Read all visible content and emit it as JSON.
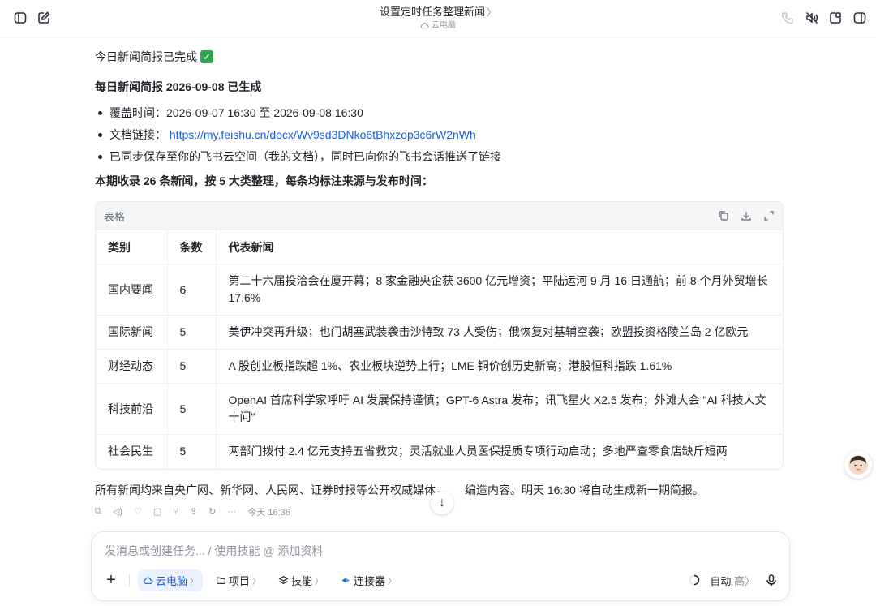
{
  "header": {
    "title": "设置定时任务整理新闻",
    "title_chevron": "〉",
    "subtitle": "云电脑"
  },
  "message": {
    "done_line": "今日新闻简报已完成",
    "heading": "每日新闻简报 2026-09-08 已生成",
    "bullets": [
      {
        "label": "覆盖时间：",
        "value": "2026-09-07 16:30 至 2026-09-08 16:30"
      },
      {
        "label": "文档链接：",
        "value": "https://my.feishu.cn/docx/Wv9sd3DNko6tBhxzop3c6rW2nWh"
      },
      {
        "label": "",
        "value": "已同步保存至你的飞书云空间（我的文档），同时已向你的飞书会话推送了链接"
      }
    ],
    "summary_heading": "本期收录 26 条新闻，按 5 大类整理，每条均标注来源与发布时间：",
    "footer": "所有新闻均来自央广网、新华网、人民网、证券时报等公开权威媒体，",
    "footer_tail": "编造内容。明天 16:30 将自动生成新一期简报。",
    "meta_time": "今天 16:36"
  },
  "table": {
    "label": "表格",
    "headers": [
      "类别",
      "条数",
      "代表新闻"
    ],
    "rows": [
      {
        "category": "国内要闻",
        "count": "6",
        "news": "第二十六届投洽会在厦开幕；8 家金融央企获 3600 亿元增资；平陆运河 9 月 16 日通航；前 8 个月外贸增长 17.6%"
      },
      {
        "category": "国际新闻",
        "count": "5",
        "news": "美伊冲突再升级；也门胡塞武装袭击沙特致 73 人受伤；俄恢复对基辅空袭；欧盟投资格陵兰岛 2 亿欧元"
      },
      {
        "category": "财经动态",
        "count": "5",
        "news": "A 股创业板指跌超 1%、农业板块逆势上行；LME 铜价创历史新高；港股恒科指跌 1.61%"
      },
      {
        "category": "科技前沿",
        "count": "5",
        "news": "OpenAI 首席科学家呼吁 AI 发展保持谨慎；GPT-6 Astra 发布；讯飞星火 X2.5 发布；外滩大会 \"AI 科技人文十问\""
      },
      {
        "category": "社会民生",
        "count": "5",
        "news": "两部门拨付 2.4 亿元支持五省救灾；灵活就业人员医保提质专项行动启动；多地严查零食店缺斤短两"
      }
    ]
  },
  "composer": {
    "placeholder": "发消息或创建任务... / 使用技能 @ 添加资料",
    "chips": [
      "云电脑",
      "项目",
      "技能",
      "连接器"
    ],
    "mode": "自动",
    "mode_level": "高"
  }
}
